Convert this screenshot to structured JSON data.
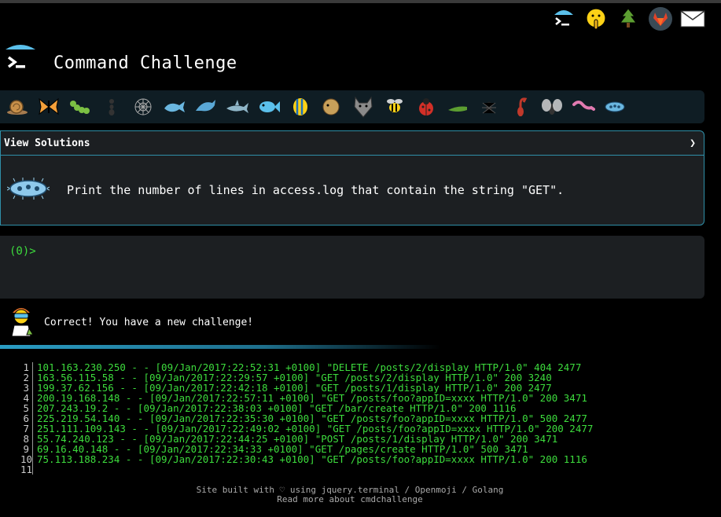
{
  "header": {
    "title": "Command Challenge"
  },
  "top_icons": [
    "cmd-logo-icon",
    "shush-face-icon",
    "tree-icon",
    "gitlab-icon",
    "mail-icon"
  ],
  "critters": [
    "snail-icon",
    "butterfly-icon",
    "caterpillar-icon",
    "ant-icon",
    "spiderweb-icon",
    "whale-icon",
    "dolphin-icon",
    "shark-icon",
    "fish-icon",
    "tropical-fish-icon",
    "blowfish-icon",
    "wolf-icon",
    "bee-icon",
    "ladybug-icon",
    "cricket-icon",
    "spider-icon",
    "scorpion-icon",
    "fly-icon",
    "worm-icon",
    "microbe-icon"
  ],
  "challenge": {
    "solutions_label": "View Solutions",
    "chevron": "❯",
    "text": "Print the number of lines in access.log that contain the string \"GET\"."
  },
  "terminal": {
    "prompt": "(0)>"
  },
  "status": {
    "message": "Correct! You have a new challenge!"
  },
  "access_log": [
    {
      "n": "1",
      "text": "101.163.230.250 - - [09/Jan/2017:22:52:31 +0100] \"DELETE /posts/2/display HTTP/1.0\" 404 2477"
    },
    {
      "n": "2",
      "text": "163.56.115.58 - - [09/Jan/2017:22:29:57 +0100] \"GET /posts/2/display HTTP/1.0\" 200 3240"
    },
    {
      "n": "3",
      "text": "199.37.62.156 - - [09/Jan/2017:22:42:18 +0100] \"GET /posts/1/display HTTP/1.0\" 200 2477"
    },
    {
      "n": "4",
      "text": "200.19.168.148 - - [09/Jan/2017:22:57:11 +0100] \"GET /posts/foo?appID=xxxx HTTP/1.0\" 200 3471"
    },
    {
      "n": "5",
      "text": "207.243.19.2 - - [09/Jan/2017:22:38:03 +0100] \"GET /bar/create HTTP/1.0\" 200 1116"
    },
    {
      "n": "6",
      "text": "225.219.54.140 - - [09/Jan/2017:22:35:30 +0100] \"GET /posts/foo?appID=xxxx HTTP/1.0\" 500 2477"
    },
    {
      "n": "7",
      "text": "251.111.109.143 - - [09/Jan/2017:22:49:02 +0100] \"GET /posts/foo?appID=xxxx HTTP/1.0\" 200 2477"
    },
    {
      "n": "8",
      "text": "55.74.240.123 - - [09/Jan/2017:22:44:25 +0100] \"POST /posts/1/display HTTP/1.0\" 200 3471"
    },
    {
      "n": "9",
      "text": "69.16.40.148 - - [09/Jan/2017:22:34:33 +0100] \"GET /pages/create HTTP/1.0\" 500 3471"
    },
    {
      "n": "10",
      "text": "75.113.188.234 - - [09/Jan/2017:22:30:43 +0100] \"GET /posts/foo?appID=xxxx HTTP/1.0\" 200 1116"
    },
    {
      "n": "11",
      "text": ""
    }
  ],
  "footer": {
    "line1": "Site built with ♡ using jquery.terminal / Openmoji / Golang",
    "line2": "Read more about cmdchallenge"
  },
  "colors": {
    "accent": "#2f8fa8",
    "terminal_green": "#3ddc3d",
    "panel": "#1c1f22"
  }
}
